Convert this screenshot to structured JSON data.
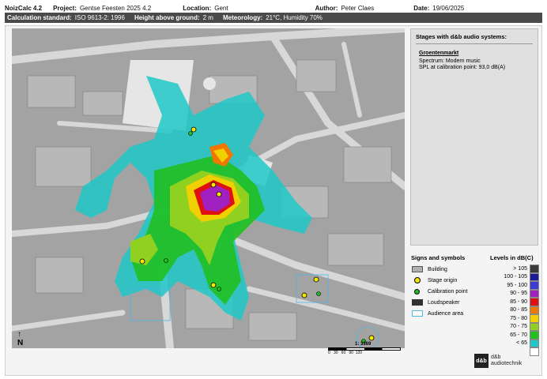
{
  "header": {
    "app": "NoizCalc 4.2",
    "project_label": "Project:",
    "project": "Gentse Feesten 2025 4.2",
    "location_label": "Location:",
    "location": "Gent",
    "author_label": "Author:",
    "author": "Peter Claes",
    "date_label": "Date:",
    "date": "19/06/2025"
  },
  "subheader": {
    "calc_label": "Calculation standard:",
    "calc": "ISO 9613-2: 1996",
    "height_label": "Height above ground:",
    "height": "2 m",
    "met_label": "Meteorology:",
    "met": "21°C, Humidity 70%"
  },
  "side_panel": {
    "title": "Stages with d&b audio systems:",
    "stage_name": "Groentenmarkt",
    "spectrum": "Spectrum:  Modern music",
    "spl": "SPL at calibration point:  93,0 dB(A)"
  },
  "signs": {
    "title": "Signs and symbols",
    "items": [
      {
        "label": "Building",
        "icon": "building-icon"
      },
      {
        "label": "Stage origin",
        "icon": "stage-origin-icon"
      },
      {
        "label": "Calibration point",
        "icon": "calibration-point-icon"
      },
      {
        "label": "Loudspeaker",
        "icon": "loudspeaker-icon"
      },
      {
        "label": "Audience area",
        "icon": "audience-area-icon"
      }
    ]
  },
  "levels": {
    "title": "Levels in dB(C)",
    "items": [
      {
        "label": "> 105",
        "color": "#3a3a3a"
      },
      {
        "label": "100 - 105",
        "color": "#1a1a99"
      },
      {
        "label": "95 - 100",
        "color": "#3b3bd6"
      },
      {
        "label": "90 - 95",
        "color": "#a020c0"
      },
      {
        "label": "85 - 90",
        "color": "#e01010"
      },
      {
        "label": "80 - 85",
        "color": "#f07800"
      },
      {
        "label": "75 - 80",
        "color": "#f0d000"
      },
      {
        "label": "70 - 75",
        "color": "#90d020"
      },
      {
        "label": "65 - 70",
        "color": "#20c020"
      },
      {
        "label": "< 65",
        "color": "#20c8c8"
      },
      {
        "label": "",
        "color": "#ffffff"
      }
    ]
  },
  "map": {
    "scale_text": "1: 3369",
    "scale_ticks": "0   30   60   90  120",
    "north": "N"
  },
  "logo": {
    "mark": "d&b",
    "name_line1": "d&b",
    "name_line2": "audiotechnik"
  }
}
